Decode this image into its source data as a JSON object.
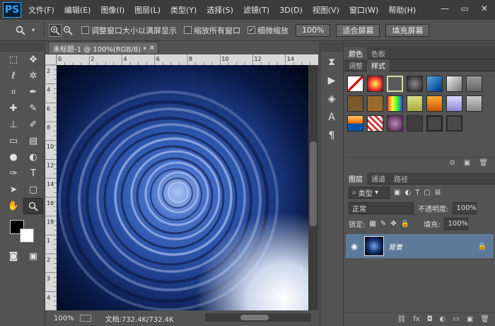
{
  "app_icon": "PS",
  "menu": [
    "文件(F)",
    "编辑(E)",
    "图像(I)",
    "图层(L)",
    "类型(Y)",
    "选择(S)",
    "滤镜(T)",
    "3D(D)",
    "视图(V)",
    "窗口(W)",
    "帮助(H)"
  ],
  "window_controls": {
    "minimize": "—",
    "restore": "▭",
    "close": "✕"
  },
  "options": {
    "check_resize": "调整窗口大小以满屏显示",
    "check_zoom_all": "缩放所有窗口",
    "check_scrubby": "细微缩放",
    "btn_100": "100%",
    "btn_fit": "适合屏幕",
    "btn_fill": "填充屏幕"
  },
  "document": {
    "tab_title": "未标题-1 @ 100%(RGB/8) *",
    "zoom": "100%",
    "status": "文档:732.4K/732.4K"
  },
  "rulers": {
    "h": [
      "0",
      "2",
      "4",
      "6",
      "8",
      "10",
      "12",
      "14"
    ],
    "v": [
      "2",
      "4",
      "6",
      "8",
      "10",
      "12",
      "14",
      "16",
      "18",
      "1",
      "2",
      "3",
      "4"
    ]
  },
  "panels": {
    "top_tabs": [
      "颜色",
      "色板"
    ],
    "second_tabs": [
      "调整",
      "样式"
    ],
    "layers_tabs": [
      "图层",
      "通道",
      "路径"
    ]
  },
  "layers": {
    "filter": "类型",
    "blend_mode": "正常",
    "opacity_label": "不透明度:",
    "opacity_value": "100%",
    "lock_label": "锁定:",
    "fill_label": "填充:",
    "fill_value": "100%",
    "items": [
      {
        "name": "背景",
        "visible": true,
        "locked": true
      }
    ]
  },
  "colors": {
    "accent": "#31a8ff",
    "foreground": "#000000",
    "background": "#ffffff",
    "selected_layer": "#5e7a9a"
  }
}
